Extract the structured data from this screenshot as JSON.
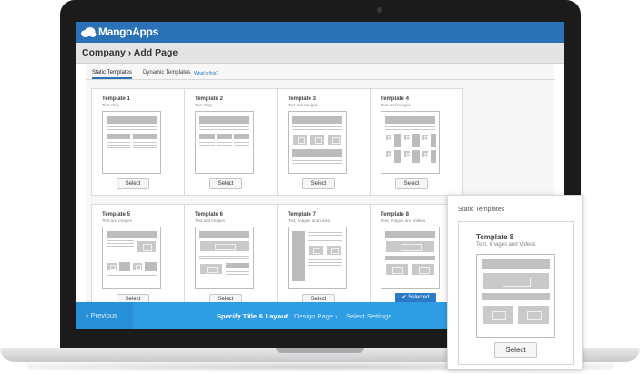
{
  "app": {
    "logo_text": "MangoApps"
  },
  "page": {
    "title": "Company › Add Page"
  },
  "tabs": [
    {
      "label": "Static Templates",
      "active": true
    },
    {
      "label": "Dynamic Templates",
      "active": false
    },
    {
      "label": "What's this?",
      "link": true
    }
  ],
  "templates": [
    {
      "title": "Template 1",
      "subtitle": "Text Only",
      "button": "Select"
    },
    {
      "title": "Template 2",
      "subtitle": "Text Only",
      "button": "Select"
    },
    {
      "title": "Template 3",
      "subtitle": "Text and Images",
      "button": "Select"
    },
    {
      "title": "Template 4",
      "subtitle": "Text and Images",
      "button": "Select"
    },
    {
      "title": "Template 5",
      "subtitle": "Text and Images",
      "button": "Select"
    },
    {
      "title": "Template 6",
      "subtitle": "Text and Images",
      "button": "Select"
    },
    {
      "title": "Template 7",
      "subtitle": "Text, Images and Links",
      "button": "Select"
    },
    {
      "title": "Template 8",
      "subtitle": "Text, Images and Videos",
      "button": "Selected"
    }
  ],
  "wizard": {
    "prev_label": "‹  Previous",
    "steps": [
      {
        "label": "Specify Title & Layout",
        "active": true
      },
      {
        "label": "›",
        "active": false
      },
      {
        "label": "Design Page",
        "active": false
      },
      {
        "label": "›",
        "active": false
      },
      {
        "label": "Select Settings",
        "active": false
      }
    ]
  },
  "popout": {
    "heading": "Static Templates",
    "title": "Template 8",
    "subtitle": "Text, Images and Videos",
    "button": "Select"
  },
  "colors": {
    "topbar": "#2a72b5",
    "wizard_bar": "#2f9de3",
    "selected": "#2a7ac8"
  }
}
